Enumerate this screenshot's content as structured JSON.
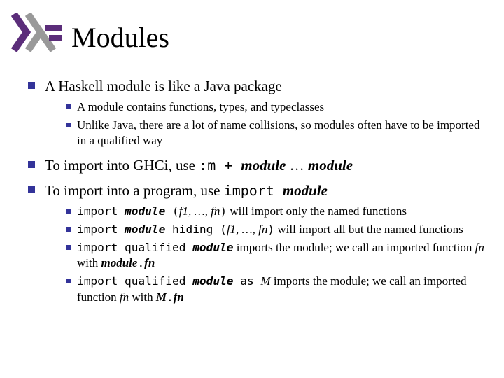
{
  "title": "Modules",
  "b1": "A Haskell module is like a Java package",
  "b1s1": "A module contains functions, types, and typeclasses",
  "b1s2": "Unlike Java, there are a lot of name collisions, so modules often have to be imported in a qualified way",
  "b2_a": "To import into GHCi, use ",
  "b2_code": ":m + ",
  "b2_m1": "module",
  "b2_dots": " … ",
  "b2_m2": "module",
  "b3_a": "To import into a program, use ",
  "b3_code": "import ",
  "b3_m": "module",
  "s31_c1": "import ",
  "s31_m": "module",
  "s31_p1": " (",
  "s31_f1": "f1",
  "s31_dots": ", …, ",
  "s31_fn": "fn",
  "s31_p2": ")",
  "s31_tail": "  will import only the named functions",
  "s32_c1": "import ",
  "s32_m": "module",
  "s32_hide": " hiding (",
  "s32_f1": "f1",
  "s32_dots": ", …, ",
  "s32_fn": "fn",
  "s32_p2": ")",
  "s32_tail": "  will import all but the named functions",
  "s33_c1": "import qualified ",
  "s33_m": "module",
  "s33_mid": " imports the module; we call an imported function ",
  "s33_fn": "fn",
  "s33_with": " with ",
  "s33_mod2": "module",
  "s33_dot": ".",
  "s33_fn2": "fn",
  "s34_c1": "import qualified ",
  "s34_m": "module",
  "s34_as": " as ",
  "s34_M": "M",
  "s34_mid": " imports the module; we call an imported function ",
  "s34_fn": "fn",
  "s34_with": " with ",
  "s34_M2": "M",
  "s34_dot": ".",
  "s34_fn2": "fn"
}
